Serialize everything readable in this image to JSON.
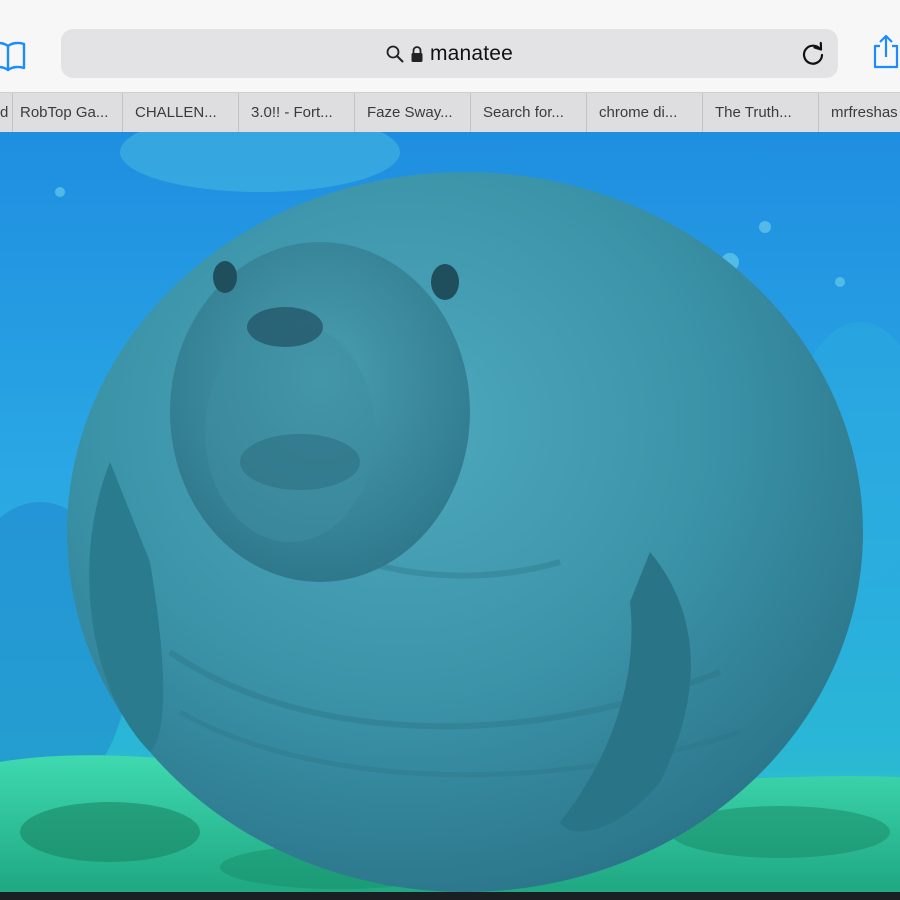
{
  "browser": {
    "address_bar": {
      "text": "manatee",
      "secure": true
    },
    "icons": {
      "bookmarks": "book-icon",
      "search": "search-icon",
      "lock": "lock-icon",
      "reload": "reload-icon",
      "share": "share-icon"
    },
    "tabs": [
      {
        "label": "d"
      },
      {
        "label": "RobTop Ga..."
      },
      {
        "label": "CHALLEN..."
      },
      {
        "label": "3.0!! - Fort..."
      },
      {
        "label": "Faze Sway..."
      },
      {
        "label": "Search for..."
      },
      {
        "label": "chrome di..."
      },
      {
        "label": "The Truth..."
      },
      {
        "label": "mrfreshas"
      }
    ]
  },
  "colors": {
    "accent": "#1a8cff",
    "water_top": "#1f8ee0",
    "water_light": "#39c4e6",
    "seafloor": "#2fd3a6",
    "manatee": "#3a98b0"
  }
}
